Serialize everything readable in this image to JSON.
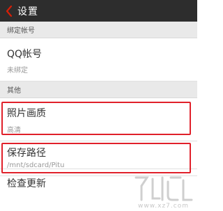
{
  "header": {
    "title": "设置"
  },
  "sections": {
    "bind_account": {
      "label": "绑定帐号"
    },
    "other": {
      "label": "其他"
    }
  },
  "items": {
    "qq_account": {
      "label": "QQ帐号",
      "value": "未绑定"
    },
    "photo_quality": {
      "label": "照片画质",
      "value": "高清"
    },
    "save_path": {
      "label": "保存路径",
      "value": "/mnt/sdcard/Pitu"
    },
    "check_update": {
      "label": "检查更新"
    }
  },
  "watermark": {
    "text": "www.xz7.com"
  },
  "colors": {
    "titlebar": "#2d2d2d",
    "back_arrow": "#d81e06",
    "highlight": "#e0202a",
    "section_bg": "#e9e9e9"
  }
}
